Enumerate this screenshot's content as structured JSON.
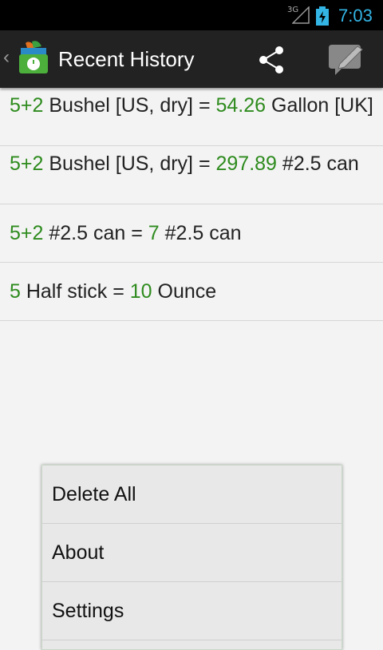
{
  "status_bar": {
    "network": "3G",
    "time": "7:03",
    "icons": [
      "signal-icon",
      "battery-charging-icon"
    ]
  },
  "action_bar": {
    "up_glyph": "‹",
    "title": "Recent History",
    "icons": [
      "app-icon",
      "share-icon",
      "compose-icon"
    ]
  },
  "history": [
    {
      "input": "5+2",
      "from": " Bushel [US, dry] = ",
      "result": "54.26",
      "to": " Gallon [UK]"
    },
    {
      "input": "5+2",
      "from": " Bushel [US, dry] = ",
      "result": "297.89",
      "to": " #2.5 can"
    },
    {
      "input": "5+2",
      "from": " #2.5 can = ",
      "result": "7",
      "to": " #2.5 can"
    },
    {
      "input": "5",
      "from": " Half stick = ",
      "result": "10",
      "to": " Ounce"
    }
  ],
  "menu": {
    "items": [
      "Delete All",
      "About",
      "Settings"
    ]
  },
  "colors": {
    "accent": "#33b5e5",
    "number": "#2e8b1e",
    "action_bar": "#222222",
    "background": "#f3f3f3"
  }
}
